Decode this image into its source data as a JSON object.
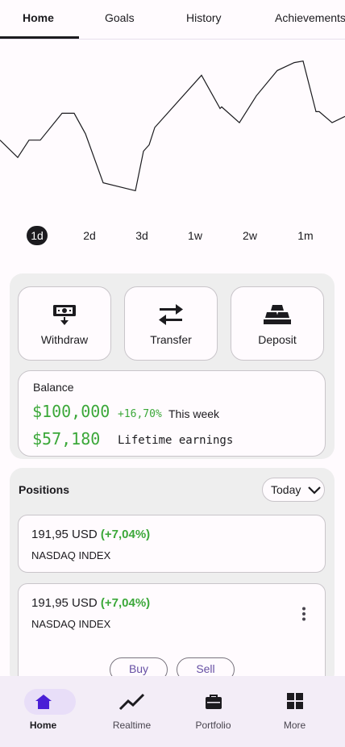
{
  "tabs": [
    {
      "label": "Home",
      "active": true
    },
    {
      "label": "Goals"
    },
    {
      "label": "History"
    },
    {
      "label": "Achievements"
    }
  ],
  "chart_data": {
    "type": "line",
    "series": [
      {
        "values": [
          42,
          31,
          42,
          42,
          59,
          59,
          46,
          15,
          10,
          35,
          39,
          50,
          83,
          62,
          63,
          53,
          70,
          86,
          91,
          92,
          60,
          60,
          53,
          57
        ]
      }
    ],
    "grid": false
  },
  "ranges": [
    "1d",
    "2d",
    "3d",
    "1w",
    "2w",
    "1m"
  ],
  "selected_range": "1d",
  "actions": [
    {
      "label": "Withdraw",
      "icon": "cash-withdraw-icon"
    },
    {
      "label": "Transfer",
      "icon": "transfer-arrows-icon"
    },
    {
      "label": "Deposit",
      "icon": "gold-bars-icon"
    }
  ],
  "balance": {
    "title": "Balance",
    "amount": "$100,000",
    "change": "+16,70%",
    "change_period": "This week",
    "lifetime_amount": "$57,180",
    "lifetime_label": "Lifetime earnings"
  },
  "positions": {
    "title": "Positions",
    "filter": "Today",
    "items": [
      {
        "price": "191,95 USD",
        "change": "(+7,04%)",
        "name": "NASDAQ INDEX"
      },
      {
        "price": "191,95 USD",
        "change": "(+7,04%)",
        "name": "NASDAQ INDEX",
        "buy_label": "Buy",
        "sell_label": "Sell"
      }
    ]
  },
  "nav": [
    {
      "label": "Home",
      "icon": "home-icon",
      "active": true
    },
    {
      "label": "Realtime",
      "icon": "trending-up-icon"
    },
    {
      "label": "Portfolio",
      "icon": "briefcase-icon"
    },
    {
      "label": "More",
      "icon": "grid-icon"
    }
  ],
  "colors": {
    "positive": "#3ca83a",
    "accent": "#6750a4",
    "nav_bg": "#f3edf7",
    "nav_pill": "#e8def8"
  }
}
